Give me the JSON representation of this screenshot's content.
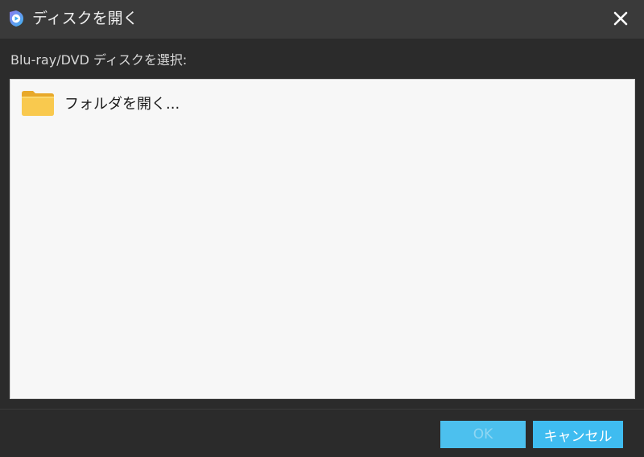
{
  "window": {
    "title": "ディスクを開く",
    "close_icon": "close-icon"
  },
  "main": {
    "section_label": "Blu-ray/DVD ディスクを選択:",
    "items": [
      {
        "icon": "folder-icon",
        "label": "フォルダを開く..."
      }
    ]
  },
  "footer": {
    "ok_label": "OK",
    "cancel_label": "キャンセル",
    "ok_enabled": false
  },
  "colors": {
    "titlebar_bg": "#3a3a3a",
    "window_bg": "#2b2b2b",
    "accent": "#3fbcf0",
    "panel_bg": "#f7f7f7"
  }
}
